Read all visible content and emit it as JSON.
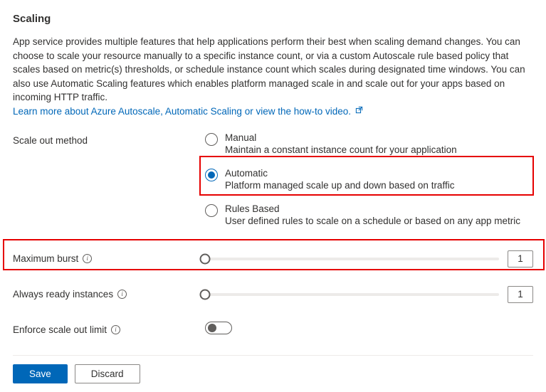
{
  "header": {
    "title": "Scaling"
  },
  "description": {
    "text": "App service provides multiple features that help applications perform their best when scaling demand changes. You can choose to scale your resource manually to a specific instance count, or via a custom Autoscale rule based policy that scales based on metric(s) thresholds, or schedule instance count which scales during designated time windows. You can also use Automatic Scaling features which enables platform managed scale in and scale out for your apps based on incoming HTTP traffic.",
    "link_label": "Learn more about Azure Autoscale, Automatic Scaling or view the how-to video."
  },
  "scale_out": {
    "label": "Scale out method",
    "options": [
      {
        "title": "Manual",
        "sub": "Maintain a constant instance count for your application",
        "selected": false
      },
      {
        "title": "Automatic",
        "sub": "Platform managed scale up and down based on traffic",
        "selected": true
      },
      {
        "title": "Rules Based",
        "sub": "User defined rules to scale on a schedule or based on any app metric",
        "selected": false
      }
    ]
  },
  "max_burst": {
    "label": "Maximum burst",
    "value": "1"
  },
  "always_ready": {
    "label": "Always ready instances",
    "value": "1"
  },
  "enforce_limit": {
    "label": "Enforce scale out limit",
    "on": false
  },
  "buttons": {
    "save": "Save",
    "discard": "Discard"
  }
}
